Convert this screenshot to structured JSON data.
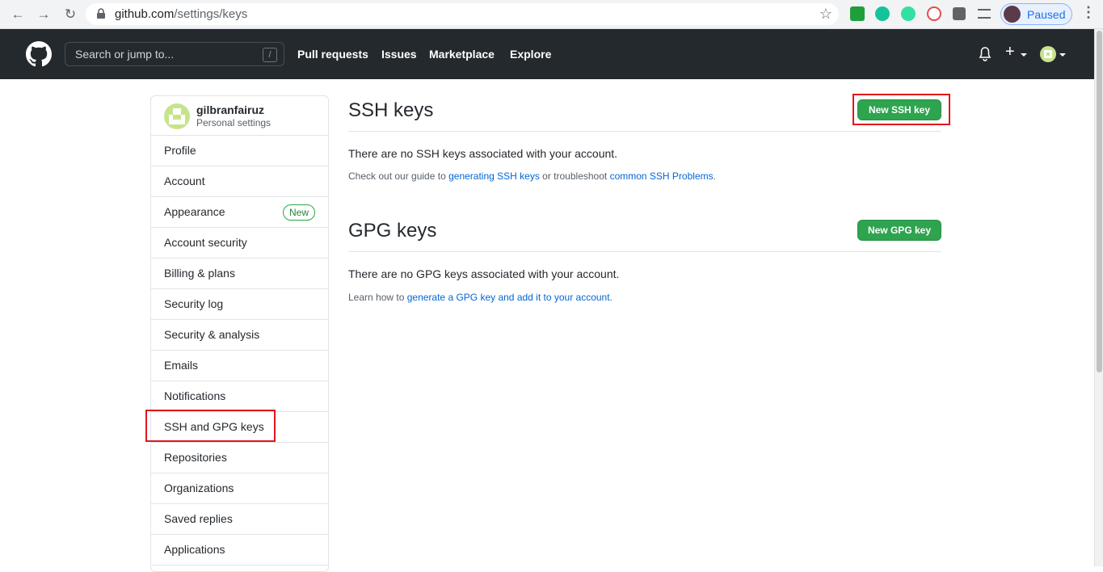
{
  "browser": {
    "url_host": "github.com",
    "url_path": "/settings/keys",
    "profile_label": "Paused"
  },
  "header": {
    "search_placeholder": "Search or jump to...",
    "search_shortcut": "/",
    "nav": [
      "Pull requests",
      "Issues",
      "Marketplace",
      "Explore"
    ]
  },
  "sidebar": {
    "username": "gilbranfairuz",
    "subtitle": "Personal settings",
    "items": [
      {
        "label": "Profile"
      },
      {
        "label": "Account"
      },
      {
        "label": "Appearance",
        "badge": "New"
      },
      {
        "label": "Account security"
      },
      {
        "label": "Billing & plans"
      },
      {
        "label": "Security log"
      },
      {
        "label": "Security & analysis"
      },
      {
        "label": "Emails"
      },
      {
        "label": "Notifications"
      },
      {
        "label": "SSH and GPG keys"
      },
      {
        "label": "Repositories"
      },
      {
        "label": "Organizations"
      },
      {
        "label": "Saved replies"
      },
      {
        "label": "Applications"
      }
    ]
  },
  "ssh": {
    "title": "SSH keys",
    "button": "New SSH key",
    "empty": "There are no SSH keys associated with your account.",
    "note_prefix": "Check out our guide to",
    "link1": "generating SSH keys",
    "note_mid": "or troubleshoot",
    "link2": "common SSH Problems",
    "note_suffix": "."
  },
  "gpg": {
    "title": "GPG keys",
    "button": "New GPG key",
    "empty": "There are no GPG keys associated with your account.",
    "note_prefix": "Learn how to",
    "link1": "generate a GPG key and add it to your account",
    "note_suffix": "."
  },
  "colors": {
    "header_bg": "#24292e",
    "primary_button": "#2ea44f",
    "link": "#0366d6",
    "highlight": "#e0161b"
  }
}
